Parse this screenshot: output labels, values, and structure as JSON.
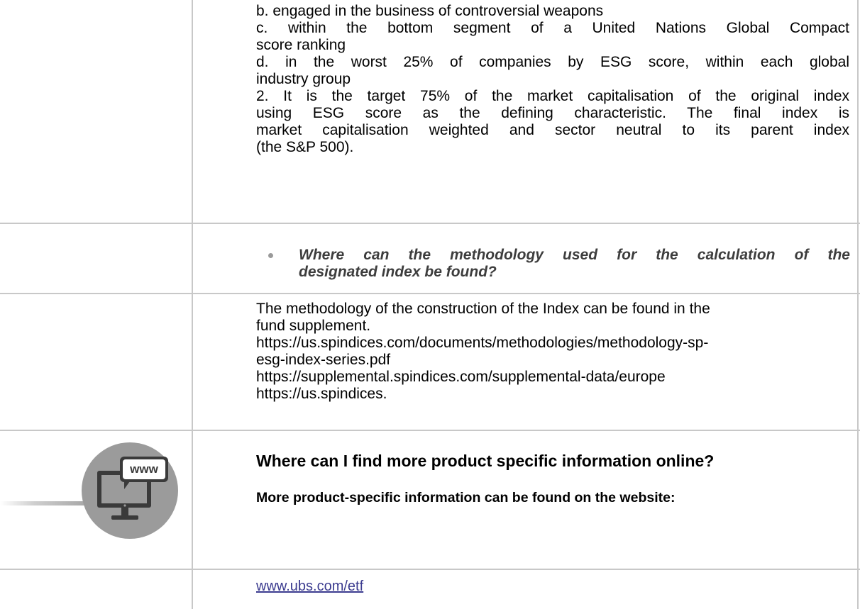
{
  "section_criteria": {
    "lines": [
      "b. engaged in the business of controversial weapons",
      "c. within the bottom segment of a United Nations Global Compact",
      "score ranking",
      "d. in the worst 25% of companies by ESG score, within each global",
      "industry group",
      "2. It is the target 75% of the market capitalisation of the original index",
      "using ESG score as the defining characteristic. The final index is",
      "market capitalisation weighted and sector neutral to its parent index",
      "(the S&P 500)."
    ]
  },
  "section_question": {
    "lines": [
      "Where can the methodology used for the calculation of the",
      "designated index be found?"
    ]
  },
  "section_answer": {
    "lines": [
      "The methodology of the construction of the Index can be found in the",
      "fund supplement.",
      "https://us.spindices.com/documents/methodologies/methodology-sp-",
      "esg-index-series.pdf",
      "https://supplemental.spindices.com/supplemental-data/europe",
      "https://us.spindices."
    ]
  },
  "section_online": {
    "heading": "Where can I find more product specific information online?",
    "subtext": "More product-specific information can be found on the website:",
    "icon_label": "www",
    "link": "www.ubs.com/etf"
  },
  "colors": {
    "border": "#c8c8c8",
    "icon_circle": "#9b9b9b",
    "icon_dark": "#3a3a3a",
    "link": "#3b3b8f",
    "bullet": "#9a9a9a"
  }
}
